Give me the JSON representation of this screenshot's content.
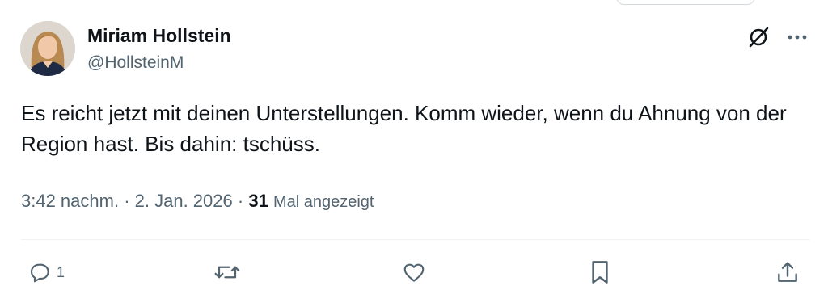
{
  "tweet": {
    "author_name": "Miriam Hollstein",
    "author_handle": "@HollsteinM",
    "text": "Es reicht jetzt mit deinen Unterstellungen. Komm wieder, wenn du Ahnung von der Region hast. Bis dahin: tschüss.",
    "time": "3:42 nachm.",
    "separator": "·",
    "date": "2. Jan. 2026",
    "view_count": "31",
    "views_label": "Mal angezeigt"
  },
  "actions": {
    "reply_count": "1",
    "retweet_count": "",
    "like_count": "",
    "icons": [
      "reply-icon",
      "retweet-icon",
      "like-icon",
      "bookmark-icon",
      "share-icon"
    ]
  },
  "colors": {
    "text": "#0f1419",
    "secondary": "#536471",
    "divider": "#eff3f4"
  }
}
